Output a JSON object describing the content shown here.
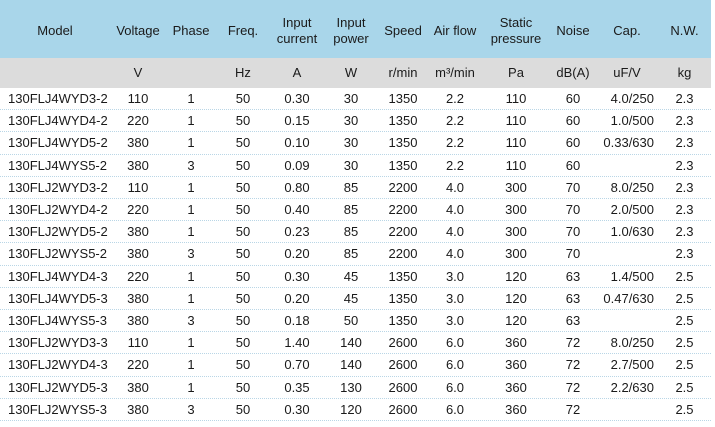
{
  "headers": [
    "Model",
    "Voltage",
    "Phase",
    "Freq.",
    "Input current",
    "Input power",
    "Speed",
    "Air flow",
    "Static pressure",
    "Noise",
    "Cap.",
    "N.W."
  ],
  "units": [
    "",
    "V",
    "",
    "Hz",
    "A",
    "W",
    "r/min",
    "m³/min",
    "Pa",
    "dB(A)",
    "uF/V",
    "kg"
  ],
  "rows": [
    [
      "130FLJ4WYD3-2",
      "110",
      "1",
      "50",
      "0.30",
      "30",
      "1350",
      "2.2",
      "110",
      "60",
      "4.0/250",
      "2.3"
    ],
    [
      "130FLJ4WYD4-2",
      "220",
      "1",
      "50",
      "0.15",
      "30",
      "1350",
      "2.2",
      "110",
      "60",
      "1.0/500",
      "2.3"
    ],
    [
      "130FLJ4WYD5-2",
      "380",
      "1",
      "50",
      "0.10",
      "30",
      "1350",
      "2.2",
      "110",
      "60",
      "0.33/630",
      "2.3"
    ],
    [
      "130FLJ4WYS5-2",
      "380",
      "3",
      "50",
      "0.09",
      "30",
      "1350",
      "2.2",
      "110",
      "60",
      "",
      "2.3"
    ],
    [
      "130FLJ2WYD3-2",
      "110",
      "1",
      "50",
      "0.80",
      "85",
      "2200",
      "4.0",
      "300",
      "70",
      "8.0/250",
      "2.3"
    ],
    [
      "130FLJ2WYD4-2",
      "220",
      "1",
      "50",
      "0.40",
      "85",
      "2200",
      "4.0",
      "300",
      "70",
      "2.0/500",
      "2.3"
    ],
    [
      "130FLJ2WYD5-2",
      "380",
      "1",
      "50",
      "0.23",
      "85",
      "2200",
      "4.0",
      "300",
      "70",
      "1.0/630",
      "2.3"
    ],
    [
      "130FLJ2WYS5-2",
      "380",
      "3",
      "50",
      "0.20",
      "85",
      "2200",
      "4.0",
      "300",
      "70",
      "",
      "2.3"
    ],
    [
      "130FLJ4WYD4-3",
      "220",
      "1",
      "50",
      "0.30",
      "45",
      "1350",
      "3.0",
      "120",
      "63",
      "1.4/500",
      "2.5"
    ],
    [
      "130FLJ4WYD5-3",
      "380",
      "1",
      "50",
      "0.20",
      "45",
      "1350",
      "3.0",
      "120",
      "63",
      "0.47/630",
      "2.5"
    ],
    [
      "130FLJ4WYS5-3",
      "380",
      "3",
      "50",
      "0.18",
      "50",
      "1350",
      "3.0",
      "120",
      "63",
      "",
      "2.5"
    ],
    [
      "130FLJ2WYD3-3",
      "110",
      "1",
      "50",
      "1.40",
      "140",
      "2600",
      "6.0",
      "360",
      "72",
      "8.0/250",
      "2.5"
    ],
    [
      "130FLJ2WYD4-3",
      "220",
      "1",
      "50",
      "0.70",
      "140",
      "2600",
      "6.0",
      "360",
      "72",
      "2.7/500",
      "2.5"
    ],
    [
      "130FLJ2WYD5-3",
      "380",
      "1",
      "50",
      "0.35",
      "130",
      "2600",
      "6.0",
      "360",
      "72",
      "2.2/630",
      "2.5"
    ],
    [
      "130FLJ2WYS5-3",
      "380",
      "3",
      "50",
      "0.30",
      "120",
      "2600",
      "6.0",
      "360",
      "72",
      "",
      "2.5"
    ]
  ],
  "colors": {
    "header_bg": "#a9d6ea",
    "units_bg": "#dcdcdc",
    "row_divider": "#b9d6e6"
  }
}
